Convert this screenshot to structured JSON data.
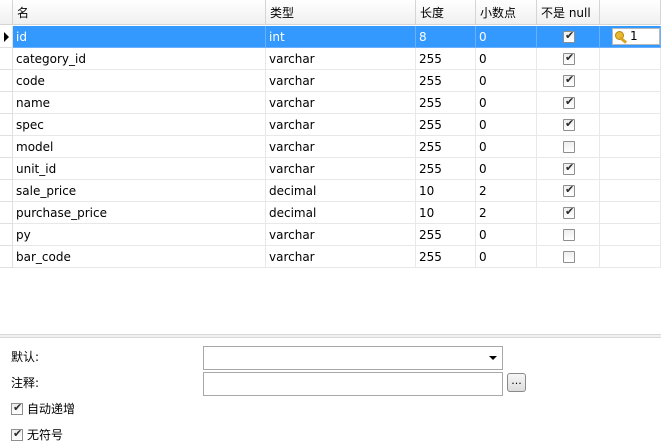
{
  "columns": {
    "name": "名",
    "type": "类型",
    "length": "长度",
    "decimals": "小数点",
    "not_null": "不是 null",
    "key": ""
  },
  "rows": [
    {
      "name": "id",
      "type": "int",
      "length": "8",
      "decimals": "0",
      "not_null": true,
      "key": "1",
      "selected": true
    },
    {
      "name": "category_id",
      "type": "varchar",
      "length": "255",
      "decimals": "0",
      "not_null": true,
      "key": "",
      "selected": false
    },
    {
      "name": "code",
      "type": "varchar",
      "length": "255",
      "decimals": "0",
      "not_null": true,
      "key": "",
      "selected": false
    },
    {
      "name": "name",
      "type": "varchar",
      "length": "255",
      "decimals": "0",
      "not_null": true,
      "key": "",
      "selected": false
    },
    {
      "name": "spec",
      "type": "varchar",
      "length": "255",
      "decimals": "0",
      "not_null": true,
      "key": "",
      "selected": false
    },
    {
      "name": "model",
      "type": "varchar",
      "length": "255",
      "decimals": "0",
      "not_null": false,
      "key": "",
      "selected": false
    },
    {
      "name": "unit_id",
      "type": "varchar",
      "length": "255",
      "decimals": "0",
      "not_null": true,
      "key": "",
      "selected": false
    },
    {
      "name": "sale_price",
      "type": "decimal",
      "length": "10",
      "decimals": "2",
      "not_null": true,
      "key": "",
      "selected": false
    },
    {
      "name": "purchase_price",
      "type": "decimal",
      "length": "10",
      "decimals": "2",
      "not_null": true,
      "key": "",
      "selected": false
    },
    {
      "name": "py",
      "type": "varchar",
      "length": "255",
      "decimals": "0",
      "not_null": false,
      "key": "",
      "selected": false
    },
    {
      "name": "bar_code",
      "type": "varchar",
      "length": "255",
      "decimals": "0",
      "not_null": false,
      "key": "",
      "selected": false
    }
  ],
  "props": {
    "default_label": "默认:",
    "default_value": "",
    "comment_label": "注释:",
    "comment_value": "",
    "ellipsis_label": "...",
    "auto_increment_label": "自动递增",
    "auto_increment": true,
    "unsigned_label": "无符号",
    "unsigned": true
  },
  "colors": {
    "selection": "#3399ff",
    "key_icon": "#e8b830"
  },
  "icons": {
    "row_pointer": "triangle-right-icon",
    "primary_key": "key-icon"
  }
}
